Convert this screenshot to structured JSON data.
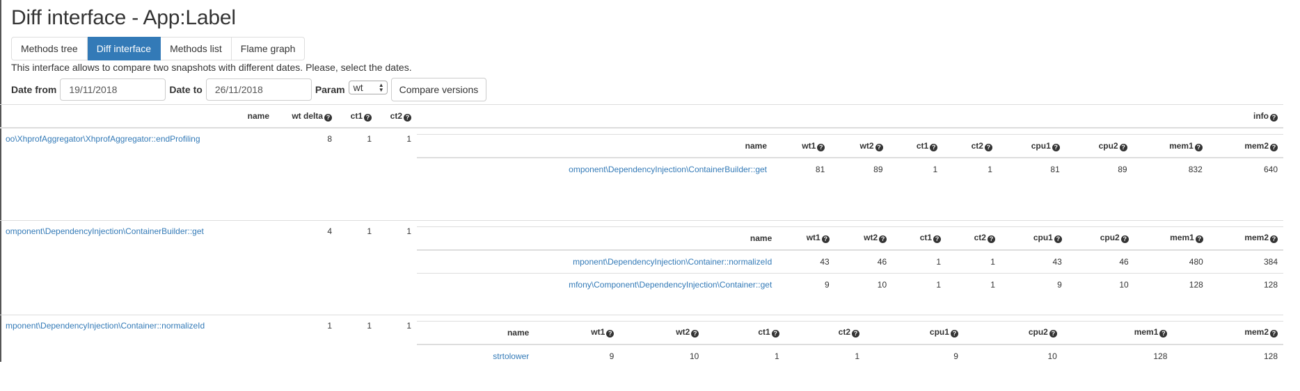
{
  "page": {
    "title": "Diff interface - App:Label",
    "description": "This interface allows to compare two snapshots with different dates. Please, select the dates."
  },
  "tabs": [
    {
      "label": "Methods tree",
      "active": false
    },
    {
      "label": "Diff interface",
      "active": true
    },
    {
      "label": "Methods list",
      "active": false
    },
    {
      "label": "Flame graph",
      "active": false
    }
  ],
  "form": {
    "date_from_label": "Date from",
    "date_from_value": "19/11/2018",
    "date_to_label": "Date to",
    "date_to_value": "26/11/2018",
    "param_label": "Param",
    "param_value": "wt",
    "compare_label": "Compare versions"
  },
  "colors": {
    "accent": "#337ab7",
    "link": "#337ab7",
    "border": "#dddddd"
  },
  "outer_table": {
    "headers": {
      "name": "name",
      "wt_delta": "wt delta",
      "ct1": "ct1",
      "ct2": "ct2",
      "info": "info"
    },
    "help_icon": "question-circle-icon",
    "rows": [
      {
        "name": "oo\\XhprofAggregator\\XhprofAggregator::endProfiling",
        "wt_delta": "8",
        "ct1": "1",
        "ct2": "1",
        "info": {
          "headers": [
            "name",
            "wt1",
            "wt2",
            "ct1",
            "ct2",
            "cpu1",
            "cpu2",
            "mem1",
            "mem2"
          ],
          "rows": [
            {
              "name": "omponent\\DependencyInjection\\ContainerBuilder::get",
              "values": [
                "81",
                "89",
                "1",
                "1",
                "81",
                "89",
                "832",
                "640"
              ]
            }
          ]
        }
      },
      {
        "name": "omponent\\DependencyInjection\\ContainerBuilder::get",
        "wt_delta": "4",
        "ct1": "1",
        "ct2": "1",
        "info": {
          "headers": [
            "name",
            "wt1",
            "wt2",
            "ct1",
            "ct2",
            "cpu1",
            "cpu2",
            "mem1",
            "mem2"
          ],
          "rows": [
            {
              "name": "mponent\\DependencyInjection\\Container::normalizeId",
              "values": [
                "43",
                "46",
                "1",
                "1",
                "43",
                "46",
                "480",
                "384"
              ]
            },
            {
              "name": "mfony\\Component\\DependencyInjection\\Container::get",
              "values": [
                "9",
                "10",
                "1",
                "1",
                "9",
                "10",
                "128",
                "128"
              ]
            }
          ]
        }
      },
      {
        "name": "mponent\\DependencyInjection\\Container::normalizeId",
        "wt_delta": "1",
        "ct1": "1",
        "ct2": "1",
        "info": {
          "headers": [
            "name",
            "wt1",
            "wt2",
            "ct1",
            "ct2",
            "cpu1",
            "cpu2",
            "mem1",
            "mem2"
          ],
          "rows": [
            {
              "name": "strtolower",
              "values": [
                "9",
                "10",
                "1",
                "1",
                "9",
                "10",
                "128",
                "128"
              ]
            }
          ]
        }
      }
    ]
  }
}
